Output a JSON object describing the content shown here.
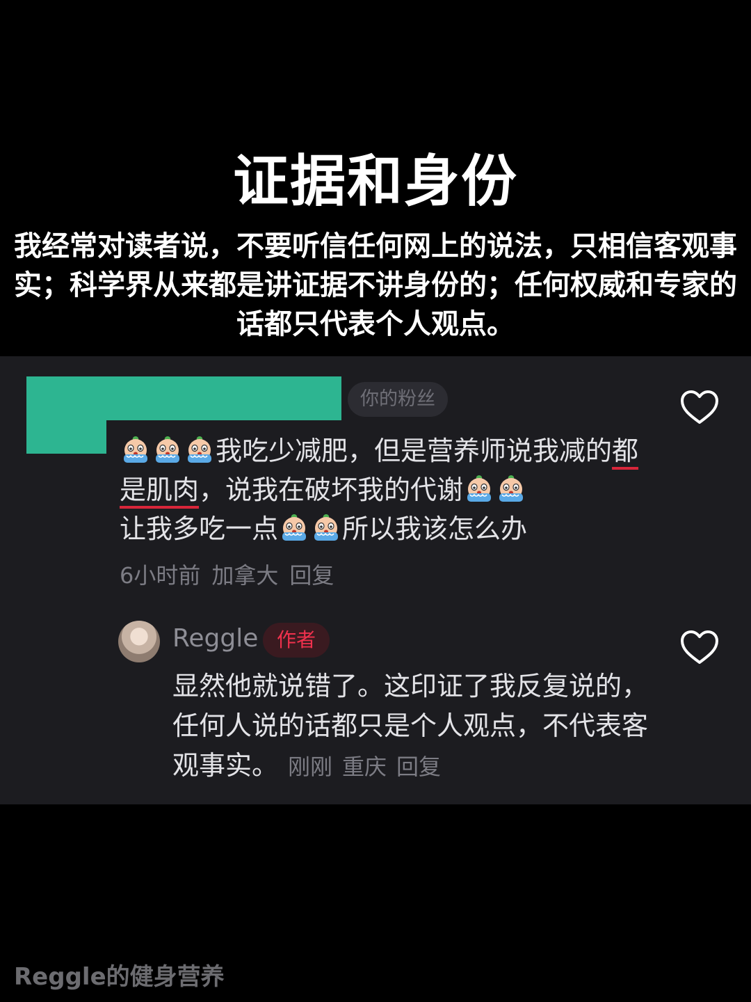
{
  "headline": "证据和身份",
  "intro": "我经常对读者说，不要听信任何网上的说法，只相信客观事实；科学界从来都是讲证据不讲身份的；任何权威和专家的话都只代表个人观点。",
  "comment": {
    "badge": "你的粉丝",
    "text_1": "我吃少减肥，但是营养师说我减的",
    "text_underlined": "都是肌肉",
    "text_2": "，说我在破坏我的代谢",
    "text_3": "让我多吃一点",
    "text_4": "所以我该怎么办",
    "time": "6小时前",
    "location": "加拿大",
    "reply_label": "回复"
  },
  "reply": {
    "username": "Reggle",
    "badge": "作者",
    "text": "显然他就说错了。这印证了我反复说的，任何人说的话都只是个人观点，不代表客观事实。",
    "time": "刚刚",
    "location": "重庆",
    "reply_label": "回复"
  },
  "watermark": "Reggle的健身营养",
  "icons": {
    "like": "heart-outline-icon",
    "emoji": "crying-emoji-icon"
  },
  "colors": {
    "redaction": "#2db591",
    "author_badge": "#f0314d",
    "underline": "#d8263a"
  }
}
